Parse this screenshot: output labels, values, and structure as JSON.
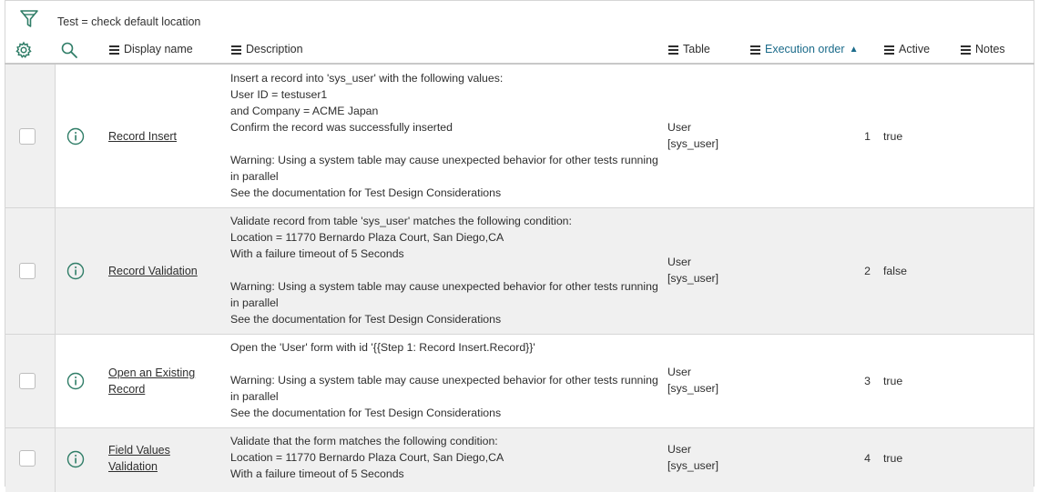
{
  "filter": {
    "text": "Test = check default location"
  },
  "columns": {
    "display_name": "Display name",
    "description": "Description",
    "table": "Table",
    "execution_order": "Execution order",
    "sort_indicator": "▲",
    "active": "Active",
    "notes": "Notes"
  },
  "icons": {
    "filter": "funnel-icon",
    "settings": "gear-icon",
    "search": "search-icon",
    "info": "info-icon",
    "column_menu": "hamburger-menu-icon"
  },
  "colors": {
    "accent": "#1b6b8a",
    "row_alt": "#f0f0f0",
    "icon": "#2f7d67"
  },
  "rows": [
    {
      "name": "Record Insert",
      "desc": [
        "Insert a record into 'sys_user' with the following values:",
        "User ID = testuser1",
        "and Company = ACME Japan",
        "Confirm the record was successfully inserted",
        "",
        "Warning: Using a system table may cause unexpected behavior for other tests running",
        "in parallel",
        "See the documentation for Test Design Considerations"
      ],
      "table_name": "User",
      "table_id": "[sys_user]",
      "order": "1",
      "active": "true"
    },
    {
      "name": "Record Validation",
      "desc": [
        "Validate record from table 'sys_user' matches the following condition:",
        "Location = 11770 Bernardo Plaza Court, San Diego,CA",
        "With a failure timeout of 5 Seconds",
        "",
        "Warning: Using a system table may cause unexpected behavior for other tests running",
        "in parallel",
        "See the documentation for Test Design Considerations"
      ],
      "table_name": "User",
      "table_id": "[sys_user]",
      "order": "2",
      "active": "false"
    },
    {
      "name": "Open an Existing Record",
      "desc": [
        "Open the 'User' form with id '{{Step 1: Record Insert.Record}}'",
        "",
        "Warning: Using a system table may cause unexpected behavior for other tests running",
        "in parallel",
        "See the documentation for Test Design Considerations"
      ],
      "table_name": "User",
      "table_id": "[sys_user]",
      "order": "3",
      "active": "true"
    },
    {
      "name": "Field Values Validation",
      "desc": [
        "Validate that the form matches the following condition:",
        "Location = 11770 Bernardo Plaza Court, San Diego,CA",
        "With a failure timeout of 5 Seconds"
      ],
      "table_name": "User",
      "table_id": "[sys_user]",
      "order": "4",
      "active": "true"
    }
  ]
}
